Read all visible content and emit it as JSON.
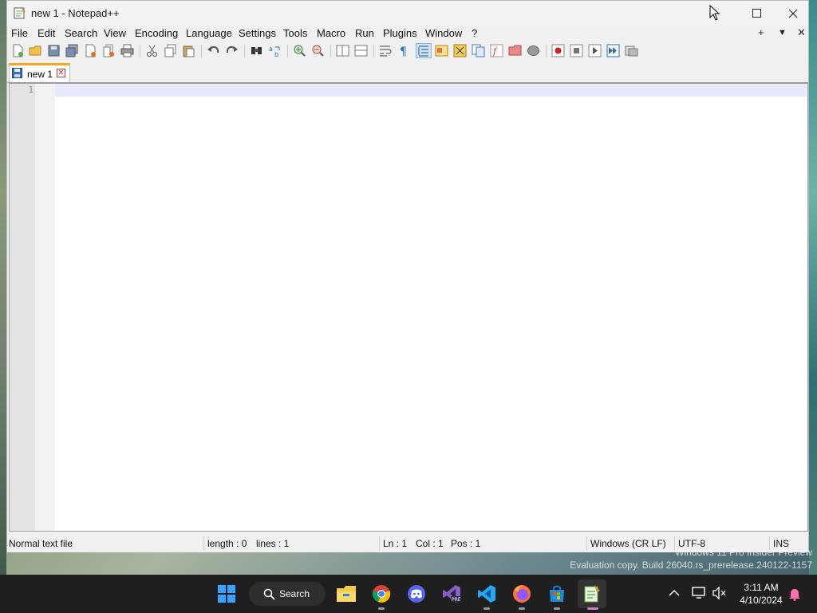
{
  "window": {
    "title": "new 1 - Notepad++",
    "controls": {
      "minimize": "minimize",
      "maximize": "maximize",
      "close": "close"
    }
  },
  "menu": {
    "items": [
      "File",
      "Edit",
      "Search",
      "View",
      "Encoding",
      "Language",
      "Settings",
      "Tools",
      "Macro",
      "Run",
      "Plugins",
      "Window",
      "?"
    ],
    "right": {
      "plus": "+",
      "dropdown": "▼",
      "close": "✕"
    }
  },
  "toolbar": {
    "buttons": [
      "new-file",
      "open-file",
      "save",
      "save-all",
      "close",
      "close-all",
      "print",
      "cut",
      "copy",
      "paste",
      "undo",
      "redo",
      "find",
      "replace",
      "zoom-in",
      "zoom-out",
      "sync-vertical",
      "sync-horizontal",
      "word-wrap",
      "show-all-characters",
      "indent-guide",
      "define-language",
      "document-map",
      "document-list",
      "function-list",
      "folder-as-workspace",
      "monitoring",
      "record-macro",
      "stop-recording",
      "playback-macro",
      "run-macro-multiple",
      "save-macro"
    ]
  },
  "tabs": [
    {
      "label": "new 1",
      "close": "✕"
    }
  ],
  "editor": {
    "line_numbers": [
      "1"
    ],
    "content": ""
  },
  "status": {
    "file_type": "Normal text file",
    "length": "length : 0",
    "lines": "lines : 1",
    "ln": "Ln : 1",
    "col": "Col : 1",
    "pos": "Pos : 1",
    "eol": "Windows (CR LF)",
    "encoding": "UTF-8",
    "mode": "INS"
  },
  "watermark": {
    "line1": "Windows 11 Pro Insider Preview",
    "line2": "Evaluation copy. Build 26040.rs_prerelease.240122-1157"
  },
  "taskbar": {
    "search_label": "Search",
    "apps": [
      "start",
      "search",
      "file-explorer",
      "chrome",
      "discord",
      "visual-studio-preview",
      "vscode",
      "firefox",
      "microsoft-store",
      "notepad-plus-plus"
    ],
    "tray": [
      "chevron-up",
      "network",
      "speaker-muted",
      "notifications"
    ],
    "time": "3:11 AM",
    "date": "4/10/2024"
  }
}
